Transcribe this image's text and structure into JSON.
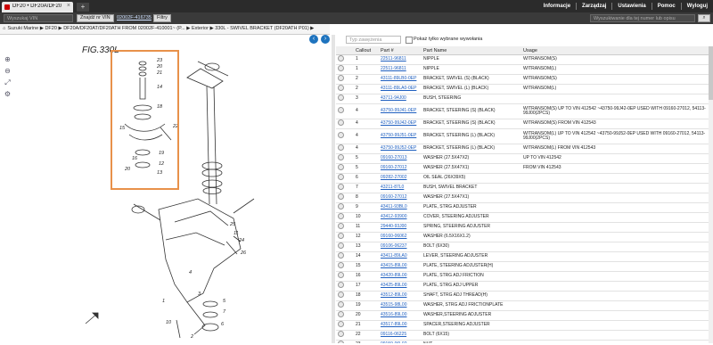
{
  "browser": {
    "tab_title": "DF20 • DF20A/DF20AR...",
    "menu": [
      "Informacje",
      "Zarządzaj",
      "Ustawienia",
      "Pomoc",
      "Wyloguj"
    ]
  },
  "toolbar": {
    "search_placeholder": "Wyszukaj VIN",
    "find_button": "Znajdź nr VIN",
    "vin_link": "02002F-416735",
    "filter_button": "Filtry",
    "part_search_placeholder": "Wyszukiwanie dla tej numer lub opisu"
  },
  "breadcrumb": "Suzuki Marine ▶ DF20 ▶ DF20A/DF20AT/DF20ATH FROM 02002F-410001~ (P... ▶ Exterior ▶ 330L - SWIVEL BRACKET (DF20ATH P01) ▶",
  "diagram": {
    "title": "FIG.330L",
    "callouts": [
      "23",
      "20",
      "21",
      "14",
      "18",
      "22",
      "15",
      "19",
      "16",
      "12",
      "20",
      "13",
      "25",
      "11",
      "24",
      "26",
      "4",
      "3",
      "5",
      "7",
      "1",
      "6",
      "10",
      "2"
    ]
  },
  "filter": {
    "placeholder": "Typ zawężenia",
    "checkbox_label": "Pokaż tylko wybrane wywołania"
  },
  "table": {
    "headers": [
      "",
      "Callout",
      "Part #",
      "Part Name",
      "Usage"
    ],
    "rows": [
      {
        "callout": "1",
        "part": "22511-96811",
        "name": "NIPPLE",
        "usage": "W/TRANSOM(S)"
      },
      {
        "callout": "1",
        "part": "22511-96811",
        "name": "NIPPLE",
        "usage": "W/TRANSOM(L)"
      },
      {
        "callout": "2",
        "part": "43111-89LB0-0EP",
        "name": "BRACKET, SWIVEL (S) (BLACK)",
        "usage": "W/TRANSOM(S)"
      },
      {
        "callout": "2",
        "part": "43111-89LA0-0EP",
        "name": "BRACKET, SWIVEL (L) (BLACK)",
        "usage": "W/TRANSOM(L)"
      },
      {
        "callout": "3",
        "part": "43711-94J00",
        "name": "BUSH, STEERING",
        "usage": ""
      },
      {
        "callout": "4",
        "part": "43750-99J41-0EP",
        "name": "BRACKET, STEERING (S) (BLACK)",
        "usage": "W/TRANSOM(S) UP TO VIN 412542 ~43750-99J42-0EP USED WITH 09160-27012, 54113-99J00(2PCS)"
      },
      {
        "callout": "4",
        "part": "43750-99J42-0EP",
        "name": "BRACKET, STEERING (S) (BLACK)",
        "usage": "W/TRANSOM(S) FROM VIN 412543"
      },
      {
        "callout": "4",
        "part": "43750-99J51-0EP",
        "name": "BRACKET, STEERING (L) (BLACK)",
        "usage": "W/TRANSOM(L) UP TO VIN 412542 ~43750-99J52-0EP USED WITH 09160-27012, 54113-99J00(2PCS)"
      },
      {
        "callout": "4",
        "part": "43750-99J52-0EP",
        "name": "BRACKET, STEERING (L) (BLACK)",
        "usage": "W/TRANSOM(L) FROM VIN 412543"
      },
      {
        "callout": "5",
        "part": "09160-27013",
        "name": "WASHER (27.5X47X2)",
        "usage": "UP TO VIN 412542"
      },
      {
        "callout": "5",
        "part": "09160-27012",
        "name": "WASHER (27.5X47X1)",
        "usage": "FROM VIN 412543"
      },
      {
        "callout": "6",
        "part": "09282-27002",
        "name": "OIL SEAL (26X39X5)",
        "usage": ""
      },
      {
        "callout": "7",
        "part": "43211-87L0",
        "name": "BUSH, SWIVEL BRACKET",
        "usage": ""
      },
      {
        "callout": "8",
        "part": "09160-27012",
        "name": "WASHER (27.5X47X1)",
        "usage": ""
      },
      {
        "callout": "9",
        "part": "43411-93BL0",
        "name": "PLATE, STRG ADJUSTER",
        "usage": ""
      },
      {
        "callout": "10",
        "part": "43412-93900",
        "name": "COVER, STEERING ADJUSTER",
        "usage": ""
      },
      {
        "callout": "11",
        "part": "29440-93J00",
        "name": "SPRING, STEERING ADJUSTER",
        "usage": ""
      },
      {
        "callout": "12",
        "part": "09160-06062",
        "name": "WASHER (6.5X16X1.2)",
        "usage": ""
      },
      {
        "callout": "13",
        "part": "09106-06237",
        "name": "BOLT (6X30)",
        "usage": ""
      },
      {
        "callout": "14",
        "part": "43411-89LA0",
        "name": "LEVER, STEERING ADJUSTER",
        "usage": ""
      },
      {
        "callout": "15",
        "part": "43415-89L00",
        "name": "PLATE, STEERING ADJUSTER(H)",
        "usage": ""
      },
      {
        "callout": "16",
        "part": "43420-89L00",
        "name": "PLATE, STRG ADJ FRICTION",
        "usage": ""
      },
      {
        "callout": "17",
        "part": "43425-89L00",
        "name": "PLATE, STRG ADJ UPPER",
        "usage": ""
      },
      {
        "callout": "18",
        "part": "43512-89L00",
        "name": "SHAFT, STRG ADJ THREAD(H)",
        "usage": ""
      },
      {
        "callout": "19",
        "part": "43515-98L00",
        "name": "WASHER, STRG ADJ FRICTIONPLATE",
        "usage": ""
      },
      {
        "callout": "20",
        "part": "43516-89L00",
        "name": "WASHER,STEERING ADJUSTER",
        "usage": ""
      },
      {
        "callout": "21",
        "part": "43517-89L00",
        "name": "SPACER,STEERING ADJUSTER",
        "usage": ""
      },
      {
        "callout": "22",
        "part": "09116-06225",
        "name": "BOLT (6X15)",
        "usage": ""
      },
      {
        "callout": "23",
        "part": "09159-06L02",
        "name": "NUT",
        "usage": ""
      },
      {
        "callout": "24",
        "part": "09161-20013",
        "name": "WASHER (20.5X32X1)",
        "usage": ""
      }
    ]
  }
}
